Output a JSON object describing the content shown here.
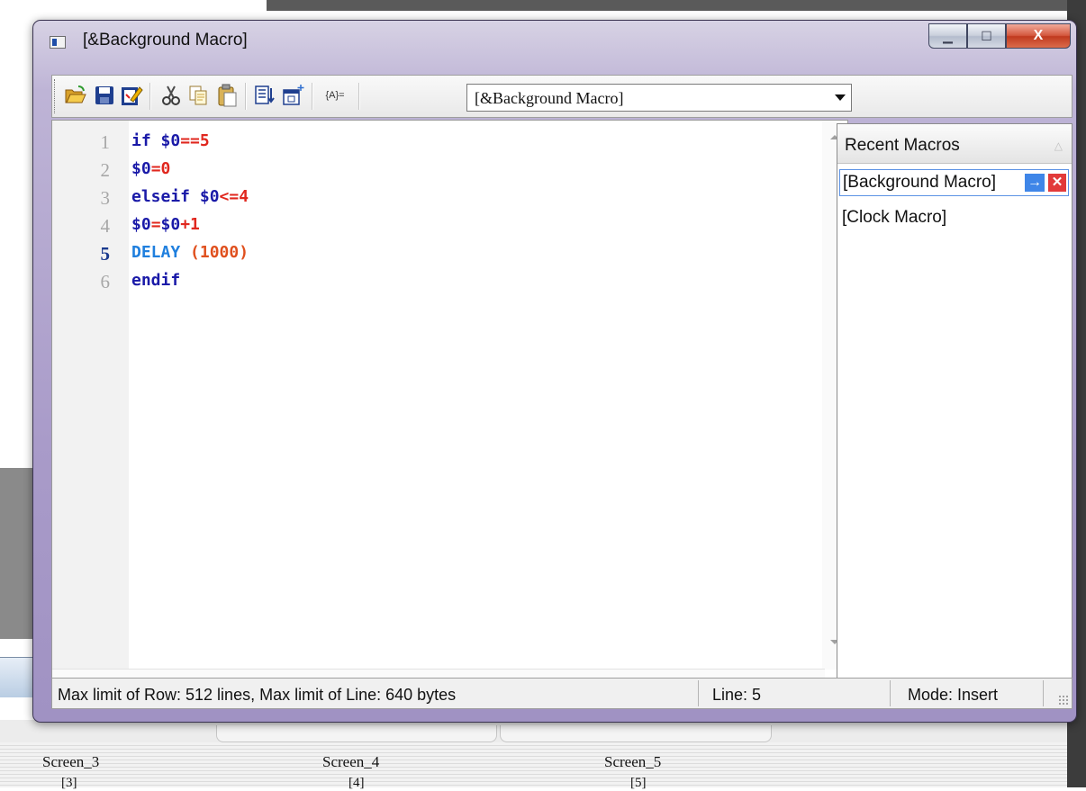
{
  "window": {
    "title": "[&Background Macro]"
  },
  "caption_buttons": {
    "minimize": "▁",
    "maximize": "☐",
    "close": "X"
  },
  "toolbar": {
    "icons": [
      "open-folder",
      "save",
      "edit",
      "cut",
      "copy",
      "paste",
      "insert-list",
      "insert-window",
      "variables"
    ],
    "variables_label": "{A}=",
    "macro_select": "[&Background Macro]"
  },
  "editor": {
    "current_line": 5,
    "lines": [
      {
        "num": "1",
        "parts": [
          {
            "t": "if ",
            "c": "kw"
          },
          {
            "t": "$0",
            "c": "var"
          },
          {
            "t": "==5",
            "c": "op"
          }
        ]
      },
      {
        "num": "2",
        "parts": [
          {
            "t": "$0",
            "c": "var"
          },
          {
            "t": "=0",
            "c": "op"
          }
        ]
      },
      {
        "num": "3",
        "parts": [
          {
            "t": "elseif ",
            "c": "kw"
          },
          {
            "t": "$0",
            "c": "var"
          },
          {
            "t": "<=4",
            "c": "op"
          }
        ]
      },
      {
        "num": "4",
        "parts": [
          {
            "t": "$0",
            "c": "var"
          },
          {
            "t": "=",
            "c": "op"
          },
          {
            "t": "$0",
            "c": "var"
          },
          {
            "t": "+1",
            "c": "op"
          }
        ]
      },
      {
        "num": "5",
        "parts": [
          {
            "t": "DELAY ",
            "c": "delay"
          },
          {
            "t": "(1000)",
            "c": "paren"
          }
        ]
      },
      {
        "num": "6",
        "parts": [
          {
            "t": "endif",
            "c": "kw"
          }
        ]
      }
    ]
  },
  "recent": {
    "title": "Recent Macros",
    "sort_glyph": "△",
    "items": [
      {
        "label": "[Background Macro]",
        "selected": true,
        "go_glyph": "→",
        "del_glyph": "✕"
      },
      {
        "label": "[Clock Macro]",
        "selected": false
      }
    ]
  },
  "status": {
    "limits": "Max limit of Row: 512 lines, Max limit of Line: 640 bytes",
    "line": "Line: 5",
    "mode": "Mode: Insert"
  },
  "background": {
    "screens": [
      {
        "label": "Screen_3",
        "num": "[3]"
      },
      {
        "label": "Screen_4",
        "num": "[4]"
      },
      {
        "label": "Screen_5",
        "num": "[5]"
      }
    ]
  },
  "colors": {
    "keyword": "#1a1aa8",
    "operator": "#e0271e",
    "delay": "#1f7fde",
    "paren": "#e0501e",
    "frame": "#a99bc9"
  }
}
